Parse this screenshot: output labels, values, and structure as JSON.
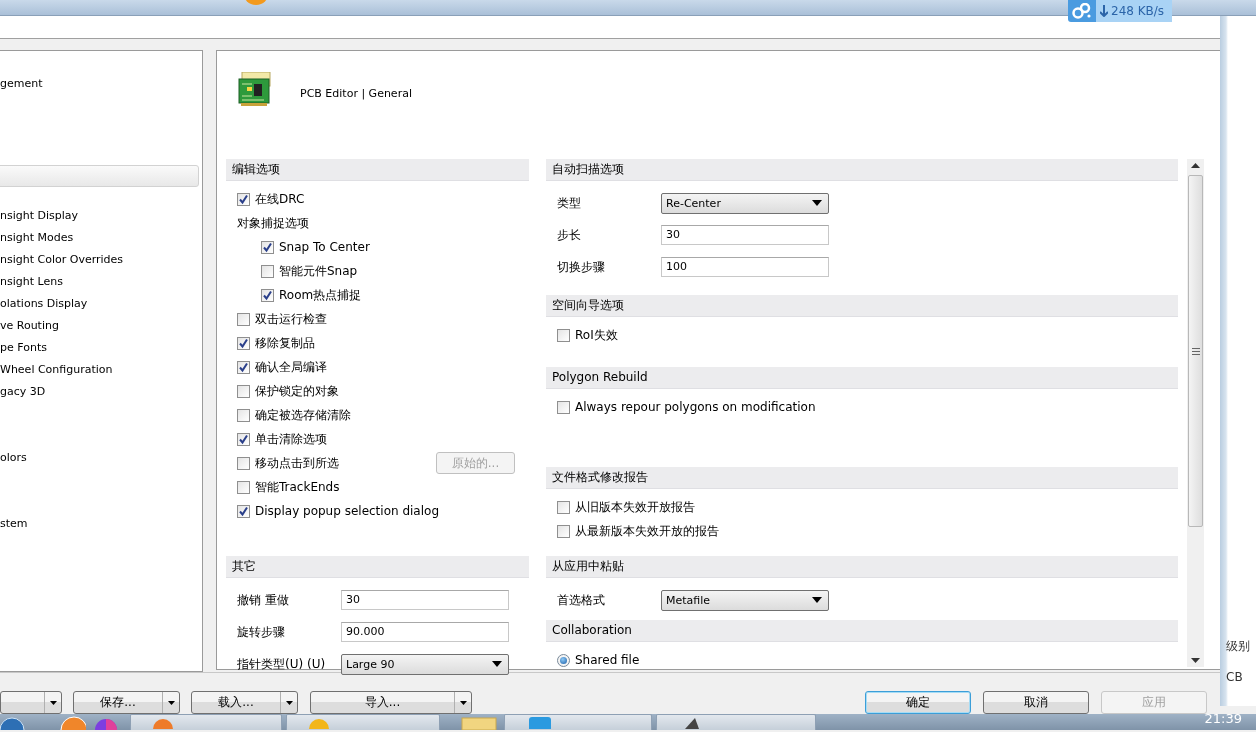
{
  "speed_widget": {
    "text": "248 KB/s"
  },
  "tree": {
    "items": [
      {
        "label": "gement",
        "selected": false
      },
      {
        "label": "nsight Display",
        "selected": false
      },
      {
        "label": "nsight Modes",
        "selected": false
      },
      {
        "label": "nsight Color Overrides",
        "selected": false
      },
      {
        "label": "nsight Lens",
        "selected": false
      },
      {
        "label": "olations Display",
        "selected": false
      },
      {
        "label": "ve Routing",
        "selected": false
      },
      {
        "label": "pe Fonts",
        "selected": false
      },
      {
        "label": "Wheel Configuration",
        "selected": false
      },
      {
        "label": "gacy 3D",
        "selected": false
      },
      {
        "label": "olors",
        "selected": false
      },
      {
        "label": "stem",
        "selected": false
      }
    ]
  },
  "page_header": {
    "title": "PCB Editor | General"
  },
  "left_sections": [
    {
      "title": "编辑选项",
      "items": [
        {
          "kind": "checkbox",
          "label": "在线DRC",
          "checked": true
        },
        {
          "kind": "label",
          "label": "对象捕捉选项",
          "children": [
            {
              "kind": "checkbox",
              "label": "Snap To Center",
              "checked": true
            },
            {
              "kind": "checkbox",
              "label": "智能元件Snap",
              "checked": false
            },
            {
              "kind": "checkbox",
              "label": "Room热点捕捉",
              "checked": true
            }
          ]
        },
        {
          "kind": "checkbox",
          "label": "双击运行检查",
          "checked": false
        },
        {
          "kind": "checkbox",
          "label": "移除复制品",
          "checked": true
        },
        {
          "kind": "checkbox",
          "label": "确认全局编译",
          "checked": true
        },
        {
          "kind": "checkbox",
          "label": "保护锁定的对象",
          "checked": false
        },
        {
          "kind": "checkbox",
          "label": "确定被选存储清除",
          "checked": false
        },
        {
          "kind": "checkbox",
          "label": "单击清除选项",
          "checked": true
        },
        {
          "kind": "checkbox",
          "label": "移动点击到所选",
          "checked": false,
          "button": {
            "label": "原始的...",
            "disabled": true
          }
        },
        {
          "kind": "checkbox",
          "label": "智能TrackEnds",
          "checked": false
        },
        {
          "kind": "checkbox",
          "label": "Display popup selection dialog",
          "checked": true
        }
      ]
    },
    {
      "title": "其它",
      "items": [
        {
          "kind": "field",
          "label": "撤销 重做",
          "value": "30"
        },
        {
          "kind": "field",
          "label": "旋转步骤",
          "value": "90.000"
        },
        {
          "kind": "select",
          "label": "指针类型(U) (U)",
          "value": "Large 90"
        }
      ]
    }
  ],
  "right_sections": [
    {
      "title": "自动扫描选项",
      "items": [
        {
          "kind": "select",
          "label": "类型",
          "value": "Re-Center"
        },
        {
          "kind": "field",
          "label": "步长",
          "value": "30"
        },
        {
          "kind": "field",
          "label": "切换步骤",
          "value": "100"
        }
      ]
    },
    {
      "title": "空间向导选项",
      "items": [
        {
          "kind": "checkbox",
          "label": "RoI失效",
          "checked": false
        }
      ]
    },
    {
      "title": "Polygon Rebuild",
      "items": [
        {
          "kind": "checkbox",
          "label": "Always repour polygons on modification",
          "checked": false
        }
      ]
    },
    {
      "title": "文件格式修改报告",
      "items": [
        {
          "kind": "checkbox",
          "label": "从旧版本失效开放报告",
          "checked": false
        },
        {
          "kind": "checkbox",
          "label": "从最新版本失效开放的报告",
          "checked": false
        }
      ]
    },
    {
      "title": "从应用中粘贴",
      "items": [
        {
          "kind": "select",
          "label": "首选格式",
          "value": "Metafile"
        }
      ]
    },
    {
      "title": "Collaboration",
      "items": [
        {
          "kind": "radio",
          "label": "Shared file",
          "selected": true
        }
      ]
    }
  ],
  "left_buttons": [
    {
      "dropdown": true
    },
    {
      "label": "保存...",
      "dropdown": true
    },
    {
      "label": "载入...",
      "dropdown": true
    },
    {
      "label": "导入...",
      "dropdown": true
    }
  ],
  "right_buttons": [
    {
      "label": "确定",
      "focused": true,
      "disabled": false
    },
    {
      "label": "取消",
      "focused": false,
      "disabled": false
    },
    {
      "label": "应用",
      "focused": false,
      "disabled": true
    }
  ],
  "side_window": {
    "texts": [
      "级别",
      "CB"
    ]
  },
  "taskbar": {
    "clock": "21:39"
  }
}
